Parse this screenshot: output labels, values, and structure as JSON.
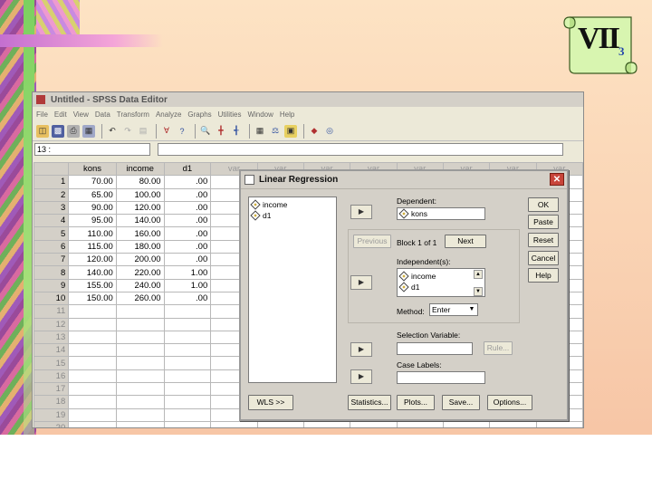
{
  "slide": {
    "label": "VII",
    "label_sub": "3"
  },
  "spss": {
    "title": "Untitled - SPSS Data Editor",
    "menu": [
      "File",
      "Edit",
      "View",
      "Data",
      "Transform",
      "Analyze",
      "Graphs",
      "Utilities",
      "Window",
      "Help"
    ],
    "cell_ref": "13 :",
    "columns": [
      "kons",
      "income",
      "d1",
      "var",
      "var",
      "var",
      "var",
      "var",
      "var",
      "var",
      "var"
    ],
    "rows": [
      {
        "n": "1",
        "kons": "70.00",
        "income": "80.00",
        "d1": ".00"
      },
      {
        "n": "2",
        "kons": "65.00",
        "income": "100.00",
        "d1": ".00"
      },
      {
        "n": "3",
        "kons": "90.00",
        "income": "120.00",
        "d1": ".00"
      },
      {
        "n": "4",
        "kons": "95.00",
        "income": "140.00",
        "d1": ".00"
      },
      {
        "n": "5",
        "kons": "110.00",
        "income": "160.00",
        "d1": ".00"
      },
      {
        "n": "6",
        "kons": "115.00",
        "income": "180.00",
        "d1": ".00"
      },
      {
        "n": "7",
        "kons": "120.00",
        "income": "200.00",
        "d1": ".00"
      },
      {
        "n": "8",
        "kons": "140.00",
        "income": "220.00",
        "d1": "1.00"
      },
      {
        "n": "9",
        "kons": "155.00",
        "income": "240.00",
        "d1": "1.00"
      },
      {
        "n": "10",
        "kons": "150.00",
        "income": "260.00",
        "d1": ".00"
      }
    ],
    "empty_rows": [
      "11",
      "12",
      "13",
      "14",
      "15",
      "16",
      "17",
      "18",
      "19",
      "20"
    ]
  },
  "dialog": {
    "title": "Linear Regression",
    "source_vars": [
      "income",
      "d1"
    ],
    "dependent_label": "Dependent:",
    "dependent_var": "kons",
    "previous_label": "Previous",
    "block_label": "Block 1 of 1",
    "next_label": "Next",
    "independent_label": "Independent(s):",
    "independent_vars": [
      "income",
      "d1"
    ],
    "method_label": "Method:",
    "method_value": "Enter",
    "selection_label": "Selection Variable:",
    "rule_label": "Rule...",
    "case_labels_label": "Case Labels:",
    "buttons": {
      "ok": "OK",
      "paste": "Paste",
      "reset": "Reset",
      "cancel": "Cancel",
      "help": "Help"
    },
    "bottom": {
      "wls": "WLS >>",
      "statistics": "Statistics...",
      "plots": "Plots...",
      "save": "Save...",
      "options": "Options..."
    }
  }
}
